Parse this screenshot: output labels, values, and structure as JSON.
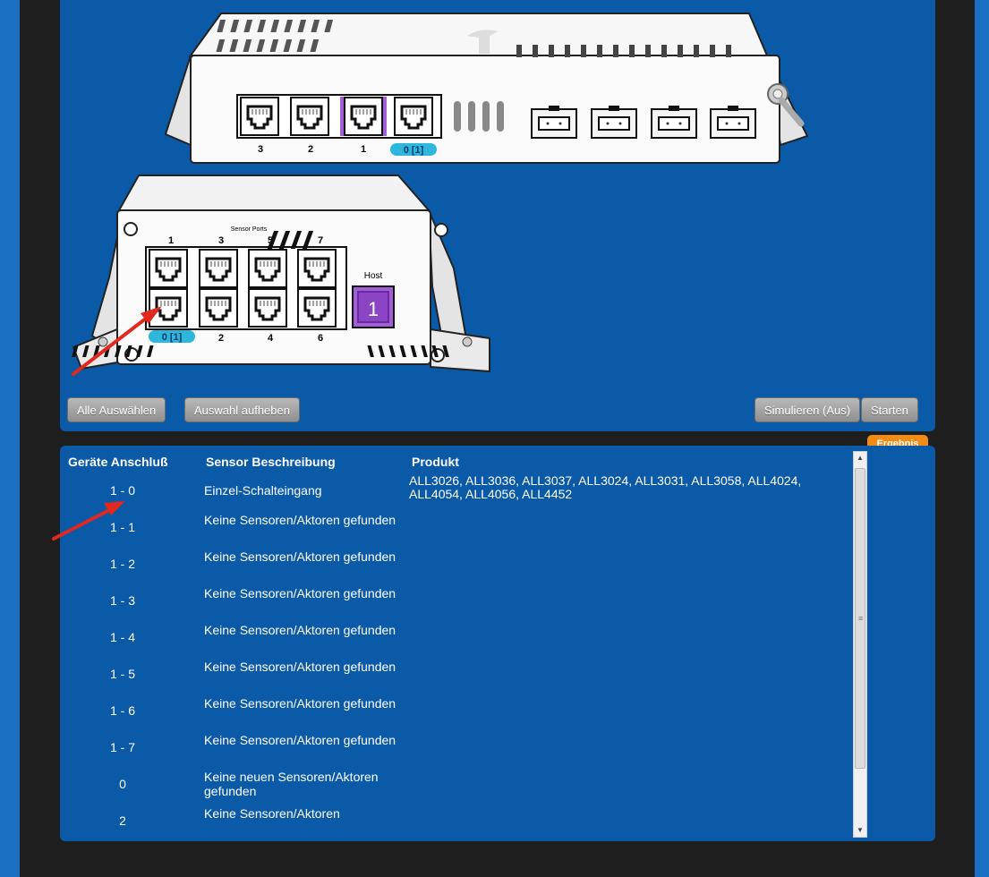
{
  "main_unit": {
    "port_labels": [
      "3",
      "2",
      "1",
      "0 [1]"
    ],
    "selected_port": "1",
    "host_badge": "0 [1]"
  },
  "sensor_unit": {
    "title": "Sensor Ports",
    "top_labels": [
      "1",
      "3",
      "5",
      "7"
    ],
    "bottom_labels": [
      "0 [1]",
      "2",
      "4",
      "6"
    ],
    "host_label": "Host",
    "host_number": "1"
  },
  "buttons": {
    "select_all": "Alle Auswählen",
    "deselect": "Auswahl aufheben",
    "simulate": "Simulieren (Aus)",
    "start": "Starten"
  },
  "result": {
    "tab": "Ergebnis",
    "headers": {
      "port": "Geräte Anschluß",
      "desc": "Sensor Beschreibung",
      "product": "Produkt"
    },
    "rows": [
      {
        "port": "1 - 0",
        "desc": "Einzel-Schalteingang",
        "product": "ALL3026, ALL3036, ALL3037, ALL3024, ALL3031, ALL3058, ALL4024, ALL4054, ALL4056, ALL4452"
      },
      {
        "port": "1 - 1",
        "desc": "Keine Sensoren/Aktoren gefunden",
        "product": ""
      },
      {
        "port": "1 - 2",
        "desc": "Keine Sensoren/Aktoren gefunden",
        "product": ""
      },
      {
        "port": "1 - 3",
        "desc": "Keine Sensoren/Aktoren gefunden",
        "product": ""
      },
      {
        "port": "1 - 4",
        "desc": "Keine Sensoren/Aktoren gefunden",
        "product": ""
      },
      {
        "port": "1 - 5",
        "desc": "Keine Sensoren/Aktoren gefunden",
        "product": ""
      },
      {
        "port": "1 - 6",
        "desc": "Keine Sensoren/Aktoren gefunden",
        "product": ""
      },
      {
        "port": "1 - 7",
        "desc": "Keine Sensoren/Aktoren gefunden",
        "product": ""
      },
      {
        "port": "0",
        "desc": "Keine neuen Sensoren/Aktoren gefunden",
        "product": ""
      },
      {
        "port": "2",
        "desc": "Keine Sensoren/Aktoren",
        "product": ""
      }
    ]
  },
  "colors": {
    "panel_blue": "#0b5aa8",
    "side_blue": "#1a6fc4",
    "selected_purple": "#a25ed6",
    "badge_cyan": "#2fb6dc",
    "tab_orange": "#f08c16",
    "annotation_red": "#e0281e"
  },
  "icons": [
    "rj45-port-icon",
    "sfp-port-icon",
    "antenna-icon",
    "screw-icon",
    "red-arrow-annotation",
    "scroll-up-icon",
    "scroll-down-icon"
  ]
}
